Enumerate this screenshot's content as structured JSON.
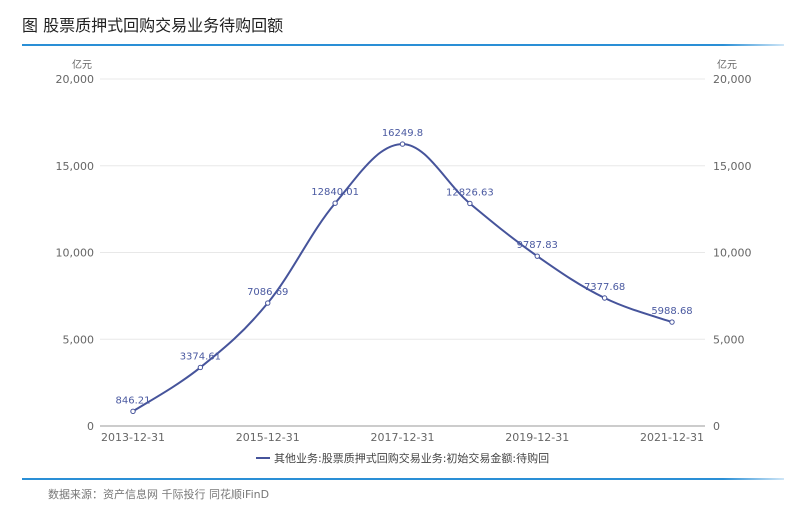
{
  "header": {
    "title": "图 股票质押式回购交易业务待购回额"
  },
  "footer": {
    "source": "数据来源：资产信息网 千际投行 同花顺iFinD"
  },
  "colors": {
    "line": "#46549b",
    "rule": "#2a8fd6",
    "grid": "#e8e8e8"
  },
  "chart_data": {
    "type": "line",
    "title": "股票质押式回购交易业务待购回额",
    "left_unit": "亿元",
    "right_unit": "亿元",
    "x_labels_shown": [
      "2013-12-31",
      "2015-12-31",
      "2017-12-31",
      "2019-12-31",
      "2021-12-31"
    ],
    "x": [
      "2013-12-31",
      "2014-12-31",
      "2015-12-31",
      "2016-12-31",
      "2017-12-31",
      "2018-12-31",
      "2019-12-31",
      "2020-12-31",
      "2021-12-31"
    ],
    "ylim": [
      0,
      20000
    ],
    "y_ticks": [
      0,
      5000,
      10000,
      15000,
      20000
    ],
    "y_tick_labels": [
      "0",
      "5,000",
      "10,000",
      "15,000",
      "20,000"
    ],
    "series": [
      {
        "name": "其他业务:股票质押式回购交易业务:初始交易金额:待购回",
        "values": [
          846.21,
          3374.61,
          7086.69,
          12840.01,
          16249.8,
          12826.63,
          9787.83,
          7377.68,
          5988.68
        ],
        "labels": [
          "846.21",
          "3374.61",
          "7086.69",
          "12840.01",
          "16249.8",
          "12826.63",
          "9787.83",
          "7377.68",
          "5988.68"
        ]
      }
    ],
    "grid": true,
    "legend": "bottom-center"
  }
}
